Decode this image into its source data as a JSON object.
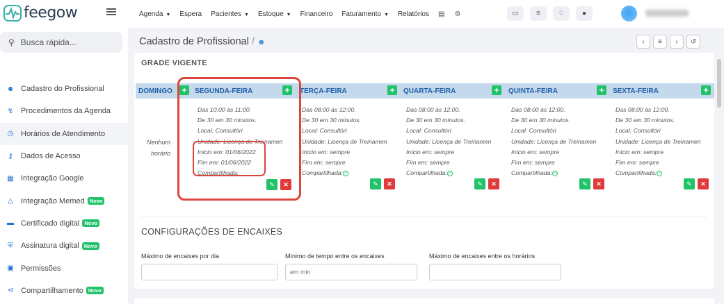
{
  "brand": {
    "name": "feegow"
  },
  "topnav": {
    "items": [
      {
        "label": "Agenda",
        "dropdown": true
      },
      {
        "label": "Espera",
        "dropdown": false
      },
      {
        "label": "Pacientes",
        "dropdown": true
      },
      {
        "label": "Estoque",
        "dropdown": true
      },
      {
        "label": "Financeiro",
        "dropdown": false
      },
      {
        "label": "Faturamento",
        "dropdown": true
      },
      {
        "label": "Relatórios",
        "dropdown": false
      }
    ],
    "icons": [
      "database-icon",
      "gear-icon"
    ],
    "right_buttons": [
      "inbox-icon",
      "tasks-list-icon",
      "bell-icon",
      "chat-icon"
    ]
  },
  "sidebar": {
    "search_placeholder": "Busca rápida...",
    "items": [
      {
        "label": "Cadastro do Profissional",
        "icon": "user-icon",
        "badge": ""
      },
      {
        "label": "Procedimentos da Agenda",
        "icon": "stethoscope-icon",
        "badge": ""
      },
      {
        "label": "Horários de Atendimento",
        "icon": "clock-icon",
        "badge": "",
        "active": true
      },
      {
        "label": "Dados de Acesso",
        "icon": "key-icon",
        "badge": ""
      },
      {
        "label": "Integração Google",
        "icon": "calendar-icon",
        "badge": ""
      },
      {
        "label": "Integração Memed",
        "icon": "flask-icon",
        "badge": "Novo"
      },
      {
        "label": "Certificado digital",
        "icon": "credit-card-icon",
        "badge": "Novo"
      },
      {
        "label": "Assinatura digital",
        "icon": "shield-icon",
        "badge": "Novo"
      },
      {
        "label": "Permissões",
        "icon": "lock-icon",
        "badge": ""
      },
      {
        "label": "Compartilhamento",
        "icon": "share-icon",
        "badge": "Novo"
      }
    ]
  },
  "page": {
    "title": "Cadastro de Profissional",
    "separator": "/",
    "buttons": [
      "chevron-left-icon",
      "list-icon",
      "chevron-right-icon",
      "history-icon"
    ]
  },
  "grade": {
    "title": "GRADE VIGENTE",
    "days": [
      "DOMINGO",
      "SEGUNDA-FEIRA",
      "TERÇA-FEIRA",
      "QUARTA-FEIRA",
      "QUINTA-FEIRA",
      "SEXTA-FEIRA",
      "S"
    ],
    "empty_text": [
      "Nenhum",
      "horário"
    ],
    "segunda": {
      "lines": [
        "Das 10:00 às 11:00.",
        "De 30 em 30 minutos.",
        "Local: Consultóri",
        "Unidade: Licença de Treinamen",
        "Início em: 01/06/2022",
        "Fim em: 01/06/2022",
        "Compartilhada:"
      ]
    },
    "others": {
      "lines": [
        "Das 08:00 às 12:00.",
        "De 30 em 30 minutos.",
        "Local: Consultóri",
        "Unidade: Licença de Treinamen",
        "Início em: sempre",
        "Fim em: sempre",
        "Compartilhada:"
      ]
    }
  },
  "encaixes": {
    "title": "CONFIGURAÇÕES DE ENCAIXES",
    "fields": [
      {
        "label": "Máximo de encaixes por dia",
        "value": ""
      },
      {
        "label": "Mínimo de tempo entre os encaixes",
        "value": "em min"
      },
      {
        "label": "Máximo de encaixes entre os horários",
        "value": ""
      }
    ]
  },
  "colors": {
    "accent": "#1f6fd6",
    "green": "#22c26b",
    "red": "#e03b3b",
    "highlight": "#d9463c",
    "header": "#c5d9ec"
  }
}
